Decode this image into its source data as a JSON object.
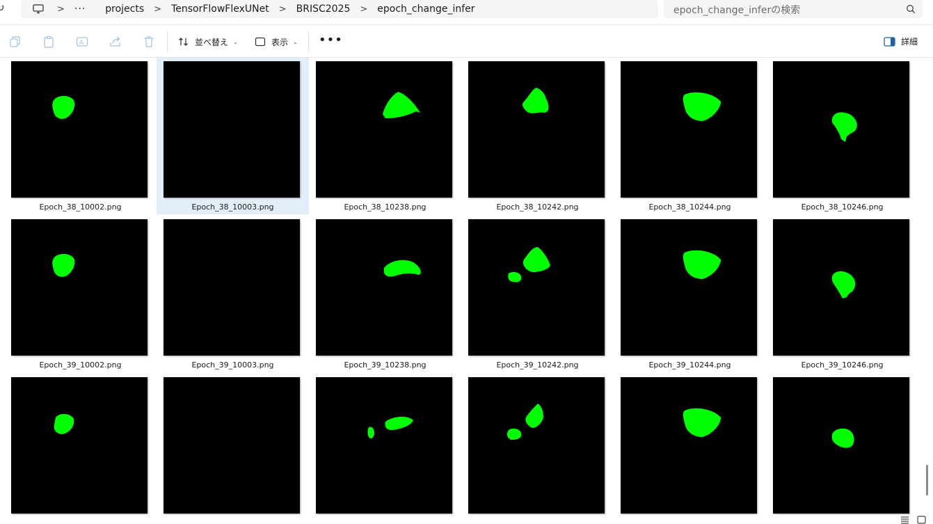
{
  "breadcrumb": {
    "more": "···",
    "items": [
      "projects",
      "TensorFlowFlexUNet",
      "BRISC2025",
      "epoch_change_infer"
    ]
  },
  "search": {
    "placeholder": "epoch_change_inferの検索"
  },
  "toolbar": {
    "sort_label": "並べ替え",
    "view_label": "表示",
    "more": "•••",
    "details_label": "詳細"
  },
  "files": [
    {
      "name": "Epoch_38_10002.png",
      "mask": "m1"
    },
    {
      "name": "Epoch_38_10003.png",
      "mask": "empty",
      "selected": true
    },
    {
      "name": "Epoch_38_10238.png",
      "mask": "m3"
    },
    {
      "name": "Epoch_38_10242.png",
      "mask": "m4"
    },
    {
      "name": "Epoch_38_10244.png",
      "mask": "m5"
    },
    {
      "name": "Epoch_38_10246.png",
      "mask": "m6"
    },
    {
      "name": "Epoch_39_10002.png",
      "mask": "m1"
    },
    {
      "name": "Epoch_39_10003.png",
      "mask": "empty"
    },
    {
      "name": "Epoch_39_10238.png",
      "mask": "m3b"
    },
    {
      "name": "Epoch_39_10242.png",
      "mask": "m4b"
    },
    {
      "name": "Epoch_39_10244.png",
      "mask": "m5"
    },
    {
      "name": "Epoch_39_10246.png",
      "mask": "m6b"
    },
    {
      "name": "",
      "mask": "m1c"
    },
    {
      "name": "",
      "mask": "empty"
    },
    {
      "name": "",
      "mask": "m3c"
    },
    {
      "name": "",
      "mask": "m4c"
    },
    {
      "name": "",
      "mask": "m5"
    },
    {
      "name": "",
      "mask": "m6c"
    }
  ],
  "colors": {
    "mask": "#00ff00",
    "selection": "#e3eefb"
  }
}
